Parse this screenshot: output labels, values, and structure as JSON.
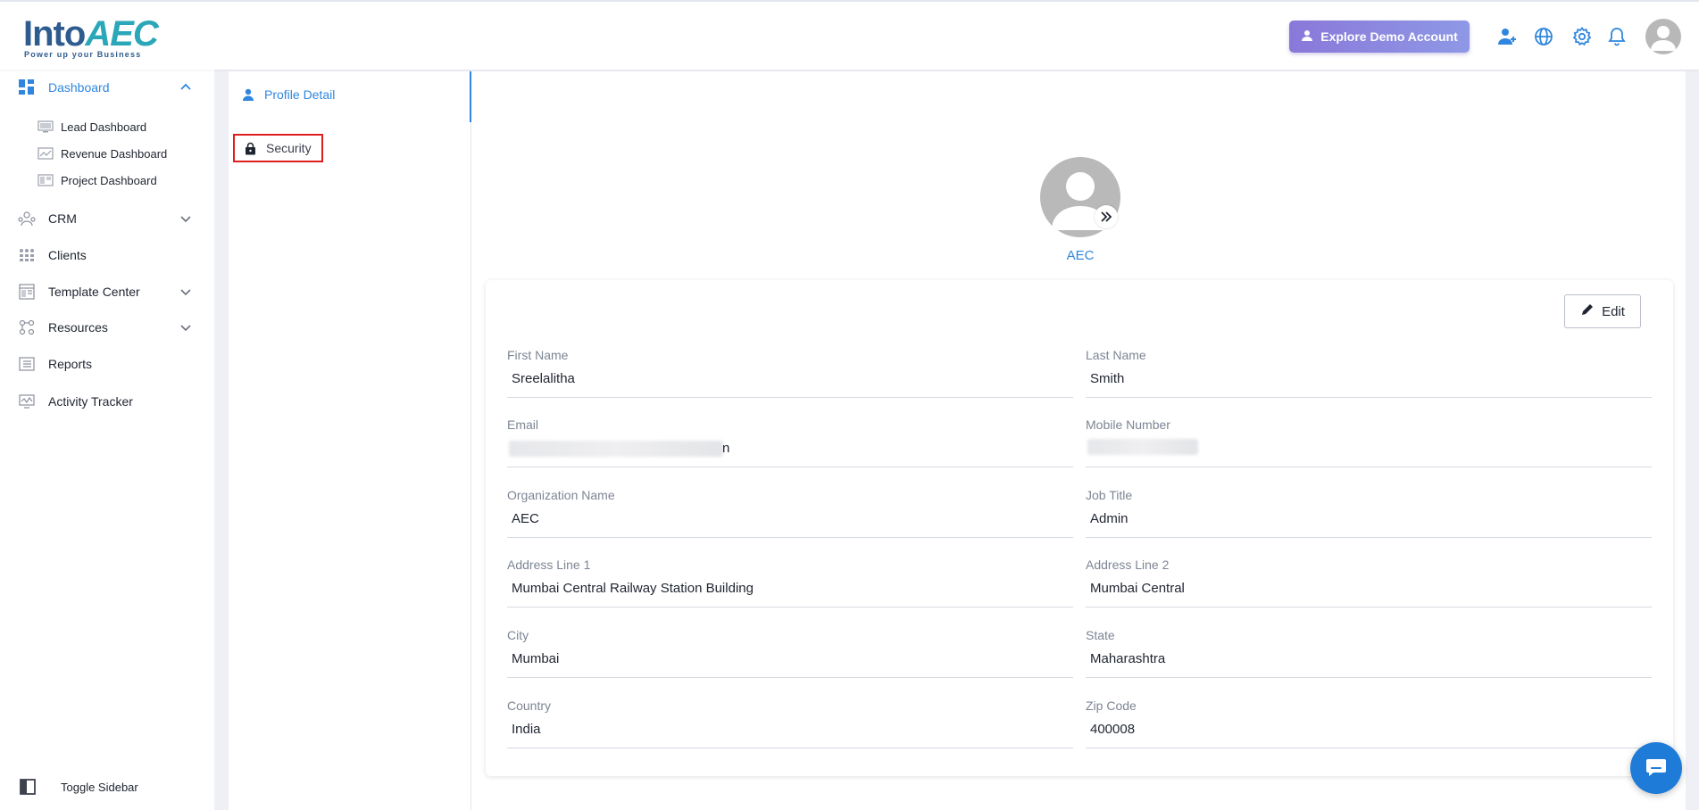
{
  "header": {
    "logo_main": "Into",
    "logo_accent": "AEC",
    "logo_tagline": "Power up your Business",
    "demo_button_label": "Explore Demo Account",
    "icons": [
      "add-user-icon",
      "globe-icon",
      "gear-icon",
      "bell-icon",
      "user-avatar-icon"
    ]
  },
  "sidebar": {
    "dashboard": {
      "label": "Dashboard",
      "expanded": true,
      "children": [
        "Lead Dashboard",
        "Revenue Dashboard",
        "Project Dashboard"
      ]
    },
    "items": [
      {
        "label": "CRM",
        "has_submenu": true
      },
      {
        "label": "Clients",
        "has_submenu": false
      },
      {
        "label": "Template Center",
        "has_submenu": true
      },
      {
        "label": "Resources",
        "has_submenu": true
      },
      {
        "label": "Reports",
        "has_submenu": false
      },
      {
        "label": "Activity Tracker",
        "has_submenu": false
      }
    ],
    "toggle_label": "Toggle Sidebar"
  },
  "profile_tabs": {
    "profile_detail": "Profile Detail",
    "security": "Security"
  },
  "profile": {
    "display_name": "AEC",
    "edit_label": "Edit",
    "fields": {
      "first_name": {
        "label": "First Name",
        "value": "Sreelalitha"
      },
      "last_name": {
        "label": "Last Name",
        "value": "Smith"
      },
      "email": {
        "label": "Email",
        "value": "n"
      },
      "mobile": {
        "label": "Mobile Number",
        "value": ""
      },
      "organization": {
        "label": "Organization Name",
        "value": "AEC"
      },
      "job_title": {
        "label": "Job Title",
        "value": "Admin"
      },
      "address1": {
        "label": "Address Line 1",
        "value": "Mumbai Central Railway Station Building"
      },
      "address2": {
        "label": "Address Line 2",
        "value": "Mumbai Central"
      },
      "city": {
        "label": "City",
        "value": "Mumbai"
      },
      "state": {
        "label": "State",
        "value": "Maharashtra"
      },
      "country": {
        "label": "Country",
        "value": "India"
      },
      "zip": {
        "label": "Zip Code",
        "value": "400008"
      }
    }
  },
  "colors": {
    "accent": "#2f86de",
    "demo_gradient_start": "#8a78d9",
    "demo_gradient_end": "#8e98e6",
    "highlight_border": "#e01d1d",
    "chat_button": "#1f7bd8"
  }
}
